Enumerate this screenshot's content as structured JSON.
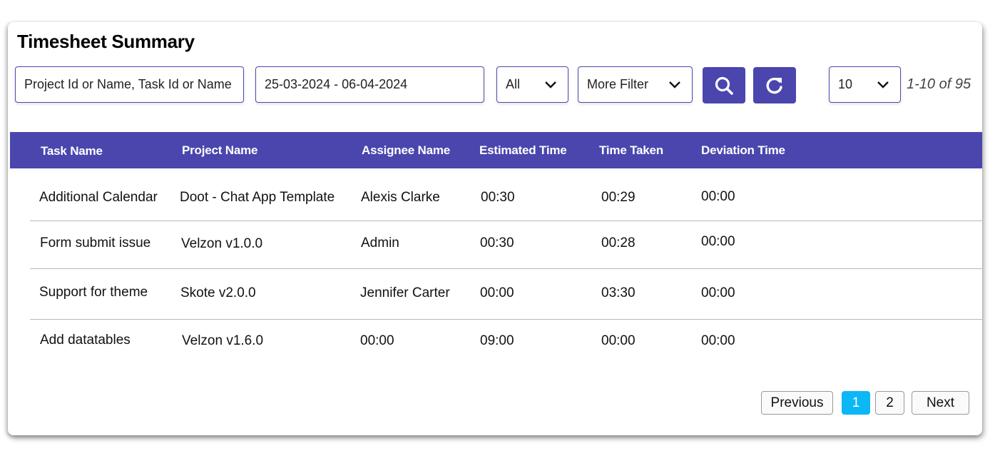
{
  "page": {
    "title": "Timesheet Summary"
  },
  "filters": {
    "search_placeholder": "Project Id or Name, Task Id or Name",
    "date_range": "25-03-2024 - 06-04-2024",
    "status_select": "All",
    "more_filter_select": "More Filter",
    "search_button_icon": "search-icon",
    "reset_button_icon": "refresh-icon",
    "page_size_select": "10",
    "range_text": "1-10 of 95"
  },
  "colors": {
    "primary": "#4a46ae",
    "active_page": "#0bb7f5"
  },
  "table": {
    "headers": [
      "Task Name",
      "Project Name",
      "Assignee Name",
      "Estimated Time",
      "Time Taken",
      "Deviation Time"
    ],
    "rows": [
      [
        "Additional Calendar",
        "Doot - Chat App Template",
        "Alexis Clarke",
        "00:30",
        "00:29",
        "00:00"
      ],
      [
        "Form submit issue",
        "Velzon v1.0.0",
        "Admin",
        "00:30",
        "00:28",
        "00:00"
      ],
      [
        "Support for theme",
        "Skote v2.0.0",
        "Jennifer Carter",
        "00:00",
        "03:30",
        "00:00"
      ],
      [
        "Add datatables",
        "Velzon v1.6.0",
        "00:00",
        "09:00",
        "00:00",
        "00:00"
      ]
    ]
  },
  "pagination": {
    "previous_label": "Previous",
    "pages": [
      "1",
      "2"
    ],
    "current_page": "1",
    "next_label": "Next"
  }
}
